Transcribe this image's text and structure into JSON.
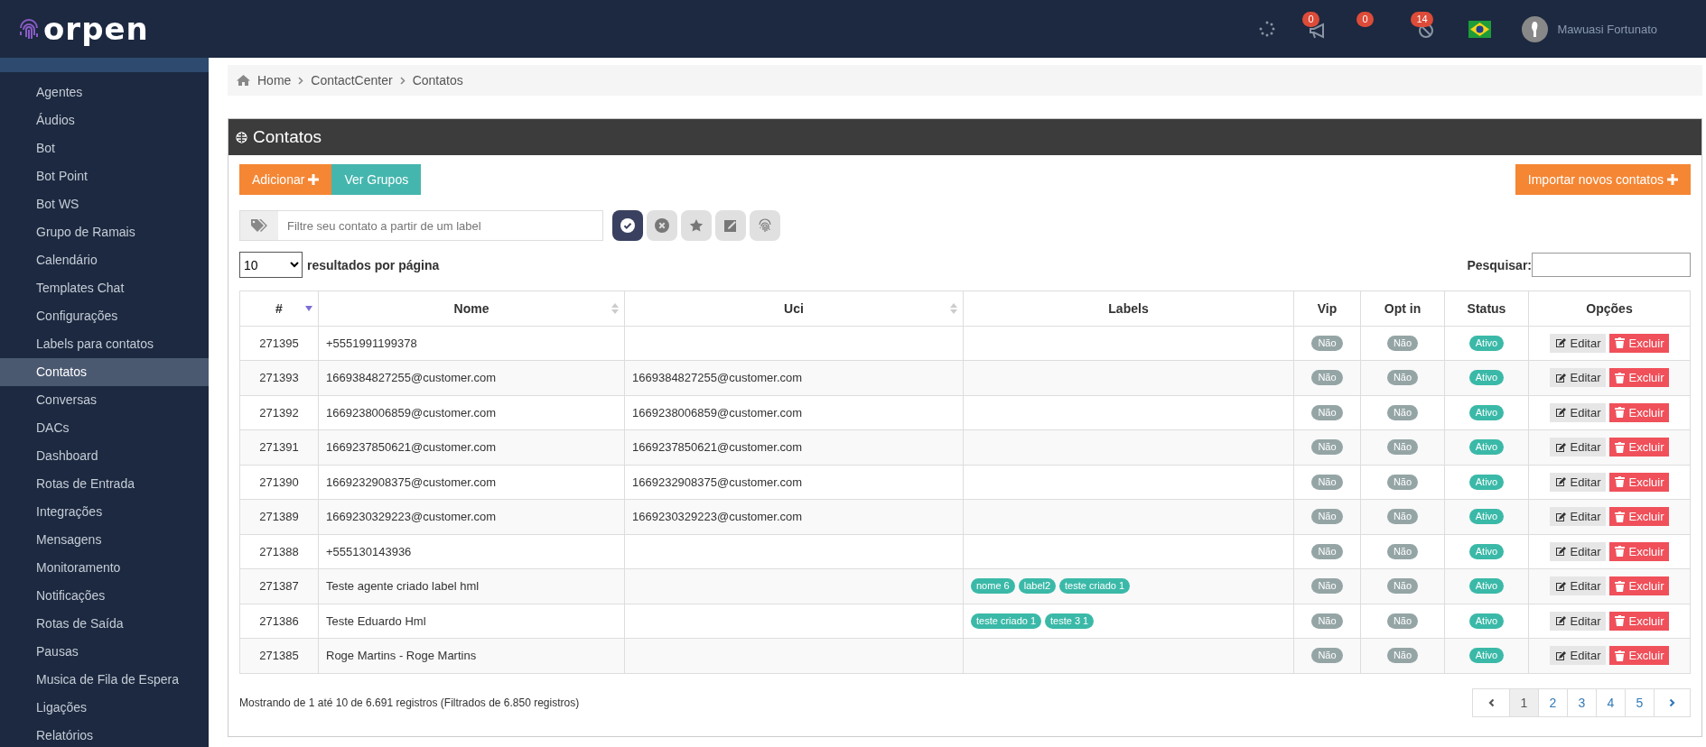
{
  "header": {
    "logo": "orpen",
    "badges": [
      {
        "kind": "megaphone",
        "count": "0"
      },
      {
        "kind": "none",
        "count": "0"
      },
      {
        "kind": "blocked",
        "count": "14"
      }
    ],
    "user": "Mawuasi Fortunato"
  },
  "sidebar": {
    "items": [
      {
        "label": "Agentes",
        "selected": false
      },
      {
        "label": "Áudios",
        "selected": false
      },
      {
        "label": "Bot",
        "selected": false
      },
      {
        "label": "Bot Point",
        "selected": false
      },
      {
        "label": "Bot WS",
        "selected": false
      },
      {
        "label": "Grupo de Ramais",
        "selected": false
      },
      {
        "label": "Calendário",
        "selected": false
      },
      {
        "label": "Templates Chat",
        "selected": false
      },
      {
        "label": "Configurações",
        "selected": false
      },
      {
        "label": "Labels para contatos",
        "selected": false
      },
      {
        "label": "Contatos",
        "selected": true
      },
      {
        "label": "Conversas",
        "selected": false
      },
      {
        "label": "DACs",
        "selected": false
      },
      {
        "label": "Dashboard",
        "selected": false
      },
      {
        "label": "Rotas de Entrada",
        "selected": false
      },
      {
        "label": "Integrações",
        "selected": false
      },
      {
        "label": "Mensagens",
        "selected": false
      },
      {
        "label": "Monitoramento",
        "selected": false
      },
      {
        "label": "Notificações",
        "selected": false
      },
      {
        "label": "Rotas de Saída",
        "selected": false
      },
      {
        "label": "Pausas",
        "selected": false
      },
      {
        "label": "Musica de Fila de Espera",
        "selected": false
      },
      {
        "label": "Ligações",
        "selected": false
      },
      {
        "label": "Relatórios",
        "selected": false
      }
    ]
  },
  "breadcrumb": [
    "Home",
    "ContactCenter",
    "Contatos"
  ],
  "panel": {
    "title": "Contatos",
    "buttons": [
      "Adicionar",
      "Ver Grupos"
    ],
    "import_button": "Importar novos contatos",
    "filter_placeholder": "Filtre seu contato a partir de um label",
    "filters": [
      {
        "kind": "check",
        "selected": true
      },
      {
        "kind": "cross",
        "selected": false
      },
      {
        "kind": "star",
        "selected": false
      },
      {
        "kind": "edit",
        "selected": false
      },
      {
        "kind": "fingerprint",
        "selected": false
      }
    ],
    "page_size": "10",
    "page_size_label": "resultados por página",
    "search_label": "Pesquisar:"
  },
  "table": {
    "columns": [
      {
        "label": "#",
        "sortable": true,
        "sorted": true
      },
      {
        "label": "Nome",
        "sortable": true,
        "sorted": false
      },
      {
        "label": "Uci",
        "sortable": true,
        "sorted": false
      },
      {
        "label": "Labels"
      },
      {
        "label": "Vip"
      },
      {
        "label": "Opt in"
      },
      {
        "label": "Status"
      },
      {
        "label": "Opções"
      }
    ],
    "rows": [
      {
        "id": "271395",
        "name": "+5551991199378",
        "vip": "Não",
        "opt_in": "Não",
        "status": "Ativo",
        "actions": [
          "Editar",
          "Excluir"
        ]
      },
      {
        "id": "271393",
        "name": "1669384827255@customer.com",
        "uci": "1669384827255@customer.com",
        "vip": "Não",
        "opt_in": "Não",
        "status": "Ativo",
        "actions": [
          "Editar",
          "Excluir"
        ]
      },
      {
        "id": "271392",
        "name": "1669238006859@customer.com",
        "uci": "1669238006859@customer.com",
        "vip": "Não",
        "opt_in": "Não",
        "status": "Ativo",
        "actions": [
          "Editar",
          "Excluir"
        ]
      },
      {
        "id": "271391",
        "name": "1669237850621@customer.com",
        "uci": "1669237850621@customer.com",
        "vip": "Não",
        "opt_in": "Não",
        "status": "Ativo",
        "actions": [
          "Editar",
          "Excluir"
        ]
      },
      {
        "id": "271390",
        "name": "1669232908375@customer.com",
        "uci": "1669232908375@customer.com",
        "vip": "Não",
        "opt_in": "Não",
        "status": "Ativo",
        "actions": [
          "Editar",
          "Excluir"
        ]
      },
      {
        "id": "271389",
        "name": "1669230329223@customer.com",
        "uci": "1669230329223@customer.com",
        "vip": "Não",
        "opt_in": "Não",
        "status": "Ativo",
        "actions": [
          "Editar",
          "Excluir"
        ]
      },
      {
        "id": "271388",
        "name": "+555130143936",
        "vip": "Não",
        "opt_in": "Não",
        "status": "Ativo",
        "actions": [
          "Editar",
          "Excluir"
        ]
      },
      {
        "id": "271387",
        "name": "Teste agente criado label hml",
        "labels": [
          "nome 6",
          "label2",
          "teste criado 1"
        ],
        "vip": "Não",
        "opt_in": "Não",
        "status": "Ativo",
        "actions": [
          "Editar",
          "Excluir"
        ]
      },
      {
        "id": "271386",
        "name": "Teste Eduardo Hml",
        "labels": [
          "teste criado 1",
          "teste 3 1"
        ],
        "vip": "Não",
        "opt_in": "Não",
        "status": "Ativo",
        "actions": [
          "Editar",
          "Excluir"
        ]
      },
      {
        "id": "271385",
        "name": "Roge Martins - Roge Martins",
        "vip": "Não",
        "opt_in": "Não",
        "status": "Ativo",
        "actions": [
          "Editar",
          "Excluir"
        ]
      }
    ]
  },
  "footer": {
    "info": "Mostrando de 1 até 10 de 6.691 registros (Filtrados de 6.850 registros)",
    "pages": [
      {
        "label": "1",
        "selected": true
      },
      {
        "label": "2",
        "selected": false
      },
      {
        "label": "3",
        "selected": false
      },
      {
        "label": "4",
        "selected": false
      },
      {
        "label": "5",
        "selected": false
      }
    ]
  }
}
